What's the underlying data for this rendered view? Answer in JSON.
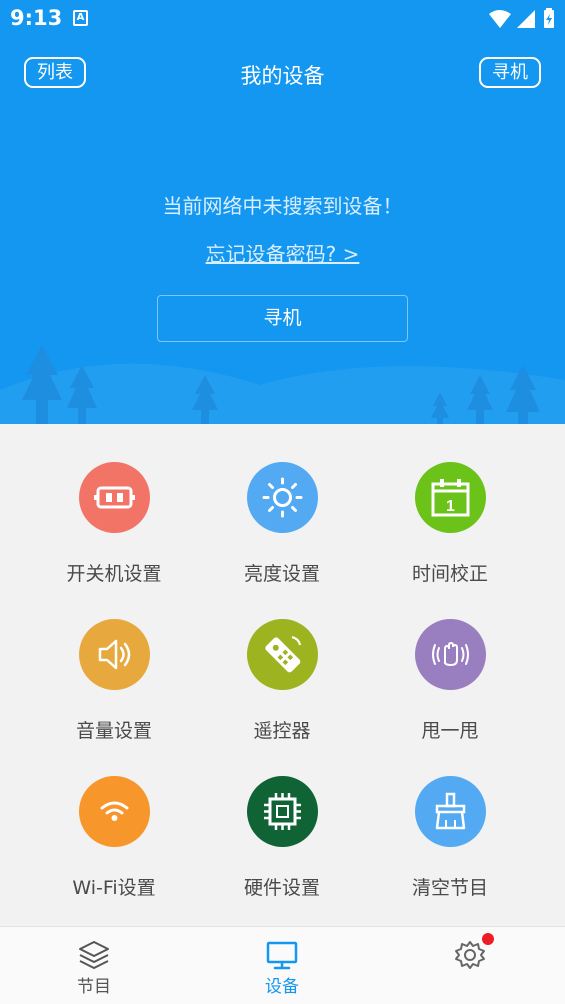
{
  "status_bar": {
    "time": "9:13",
    "a_icon": "A"
  },
  "header": {
    "left_button": "列表",
    "title": "我的设备",
    "right_button": "寻机",
    "message": "当前网络中未搜索到设备！",
    "forgot_link": "忘记设备密码? >",
    "search_button": "寻机"
  },
  "grid": {
    "items": [
      {
        "label": "开关机设置",
        "color": "#f27466",
        "icon": "power-plug-icon"
      },
      {
        "label": "亮度设置",
        "color": "#53a9f2",
        "icon": "brightness-icon"
      },
      {
        "label": "时间校正",
        "color": "#6bc219",
        "icon": "calendar-icon"
      },
      {
        "label": "音量设置",
        "color": "#e7a93e",
        "icon": "volume-icon"
      },
      {
        "label": "遥控器",
        "color": "#9eb320",
        "icon": "remote-icon"
      },
      {
        "label": "甩一甩",
        "color": "#9a7fc0",
        "icon": "shake-hand-icon"
      },
      {
        "label": "Wi-Fi设置",
        "color": "#f7962b",
        "icon": "wifi-icon"
      },
      {
        "label": "硬件设置",
        "color": "#0f6334",
        "icon": "chip-icon"
      },
      {
        "label": "清空节目",
        "color": "#53a9f2",
        "icon": "broom-icon"
      }
    ]
  },
  "bottom_nav": {
    "items": [
      {
        "label": "节目",
        "icon": "layers-icon"
      },
      {
        "label": "设备",
        "icon": "monitor-icon",
        "active": true
      },
      {
        "label": "",
        "icon": "settings-icon"
      }
    ]
  },
  "colors": {
    "primary": "#1497f0",
    "badge": "#ee1c25"
  }
}
